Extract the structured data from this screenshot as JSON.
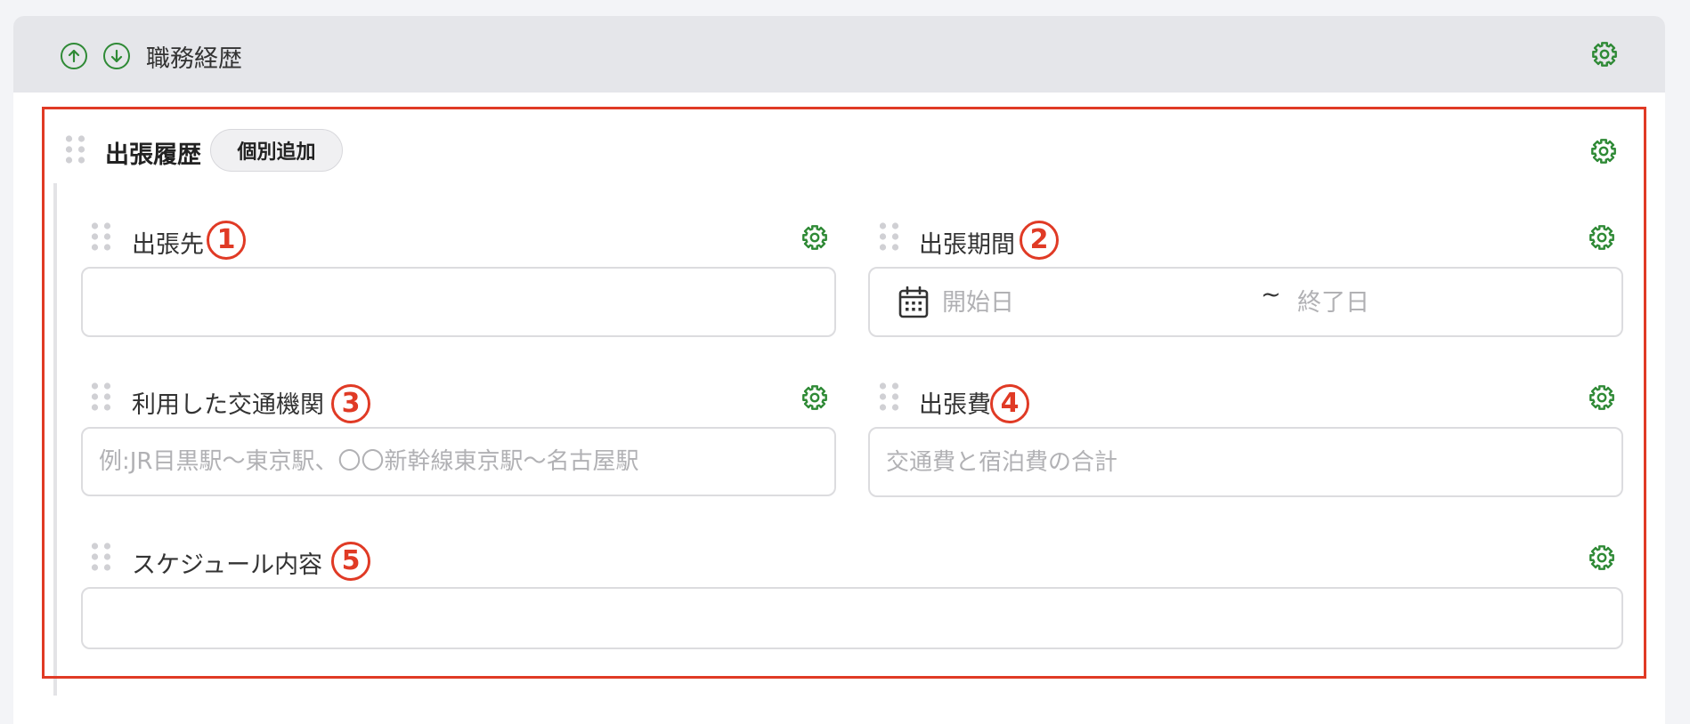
{
  "section": {
    "title": "職務経歴",
    "move_up_icon": "arrow-up-circle-icon",
    "move_down_icon": "arrow-down-circle-icon",
    "settings_icon": "gear-icon"
  },
  "group": {
    "title": "出張履歴",
    "add_button_label": "個別追加"
  },
  "fields": [
    {
      "label": "出張先",
      "marker": "1",
      "value": "",
      "placeholder": ""
    },
    {
      "label": "出張期間",
      "marker": "2",
      "start_placeholder": "開始日",
      "separator": "~",
      "end_placeholder": "終了日",
      "icon": "calendar-icon"
    },
    {
      "label": "利用した交通機関",
      "marker": "3",
      "value": "",
      "placeholder": "例:JR目黒駅〜東京駅、〇〇新幹線東京駅〜名古屋駅"
    },
    {
      "label": "出張費",
      "marker": "4",
      "value": "",
      "placeholder": "交通費と宿泊費の合計"
    },
    {
      "label": "スケジュール内容",
      "marker": "5",
      "value": "",
      "placeholder": ""
    }
  ],
  "colors": {
    "accent_green": "#2f8a36",
    "highlight_red": "#e03a25",
    "header_bg": "#e5e6ea",
    "page_bg": "#f3f4f7"
  }
}
